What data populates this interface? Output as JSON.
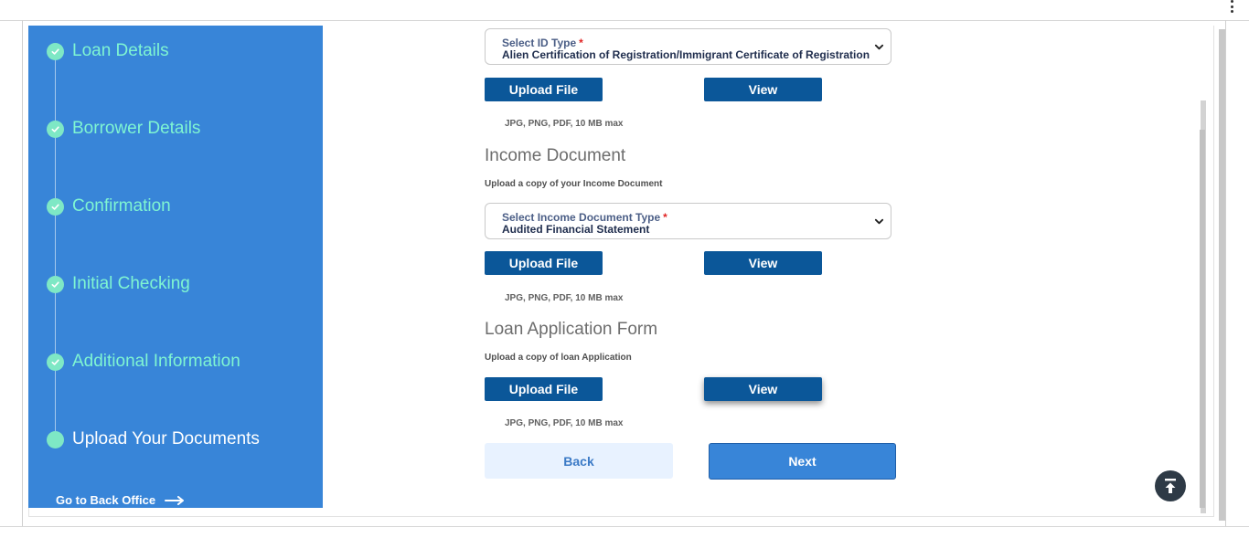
{
  "browser": {
    "menu_icon": "kebab-menu-icon"
  },
  "sidebar": {
    "steps": [
      {
        "label": "Loan Details",
        "icon": "check-circle-icon"
      },
      {
        "label": "Borrower Details",
        "icon": "check-circle-icon"
      },
      {
        "label": "Confirmation",
        "icon": "check-circle-icon"
      },
      {
        "label": "Initial Checking",
        "icon": "check-circle-icon"
      },
      {
        "label": "Additional Information",
        "icon": "check-circle-icon"
      },
      {
        "label": "Upload Your Documents",
        "icon": "current-step-dot-icon"
      }
    ],
    "back_office": {
      "label": "Go to Back Office",
      "icon": "arrow-right-icon"
    }
  },
  "id_document": {
    "select_label": "Select ID Type",
    "required_mark": "*",
    "select_value": "Alien Certification of Registration/Immigrant Certificate of Registration",
    "upload_label": "Upload File",
    "view_label": "View",
    "hint": "JPG, PNG, PDF, 10 MB max"
  },
  "income_document": {
    "title": "Income Document",
    "subtitle": "Upload a copy of your Income Document",
    "select_label": "Select Income Document Type",
    "required_mark": "*",
    "select_value": "Audited Financial Statement",
    "upload_label": "Upload File",
    "view_label": "View",
    "hint": "JPG, PNG, PDF, 10 MB max"
  },
  "loan_application_form": {
    "title": "Loan Application Form",
    "subtitle": "Upload a copy of loan Application",
    "upload_label": "Upload File",
    "view_label": "View",
    "hint": "JPG, PNG, PDF, 10 MB max"
  },
  "navigation": {
    "back_label": "Back",
    "next_label": "Next"
  },
  "scroll_to_top": {
    "icon": "arrow-up-to-line-icon"
  },
  "colors": {
    "sidebar": "#3885d8",
    "step_text": "#7ff5d2",
    "button": "#0b5799",
    "next_button": "#3885d8"
  }
}
